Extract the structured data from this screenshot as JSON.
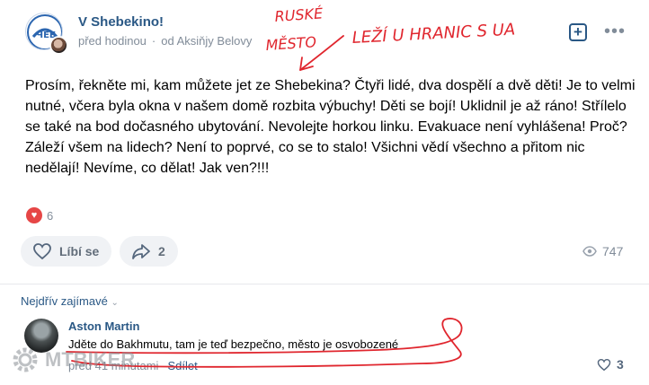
{
  "post": {
    "group_name": "V Shebekino!",
    "time": "před hodinou",
    "via": "od Aksiňjy Belovy",
    "text": "Prosím, řekněte mi, kam můžete jet ze Shebekina? Čtyři lidé, dva dospělí a dvě děti! Je to velmi nutné, včera byla okna v našem domě rozbita výbuchy! Děti se bojí! Uklidnil je až ráno! Střílelo se také na bod dočasného ubytování. Nevolejte horkou linku. Evakuace není vyhlášena! Proč? Záleží všem na lidech? Není to poprvé, co se to stalo! Všichni vědí všechno a přitom nic nedělají! Nevíme, co dělat! Jak ven?!!!",
    "reactions_count": "6",
    "like_label": "Líbí se",
    "share_count": "2",
    "views": "747"
  },
  "annotation": {
    "line1": "RUSKÉ",
    "line2": "MĚSTO",
    "line3": "LEŽÍ U HRANIC S UA"
  },
  "comments": {
    "sort_label": "Nejdřív zajímavé",
    "items": [
      {
        "author": "Aston Martin",
        "text": "Jděte do Bakhmutu, tam je teď bezpečno, město je osvobozené",
        "time": "před 41 minutami",
        "share_label": "Sdílet",
        "likes": "3"
      }
    ]
  },
  "watermark": "MTBIKER",
  "colors": {
    "link": "#2a5885",
    "muted": "#818c99",
    "heart": "#e64646",
    "handwriting": "#e0262e"
  }
}
